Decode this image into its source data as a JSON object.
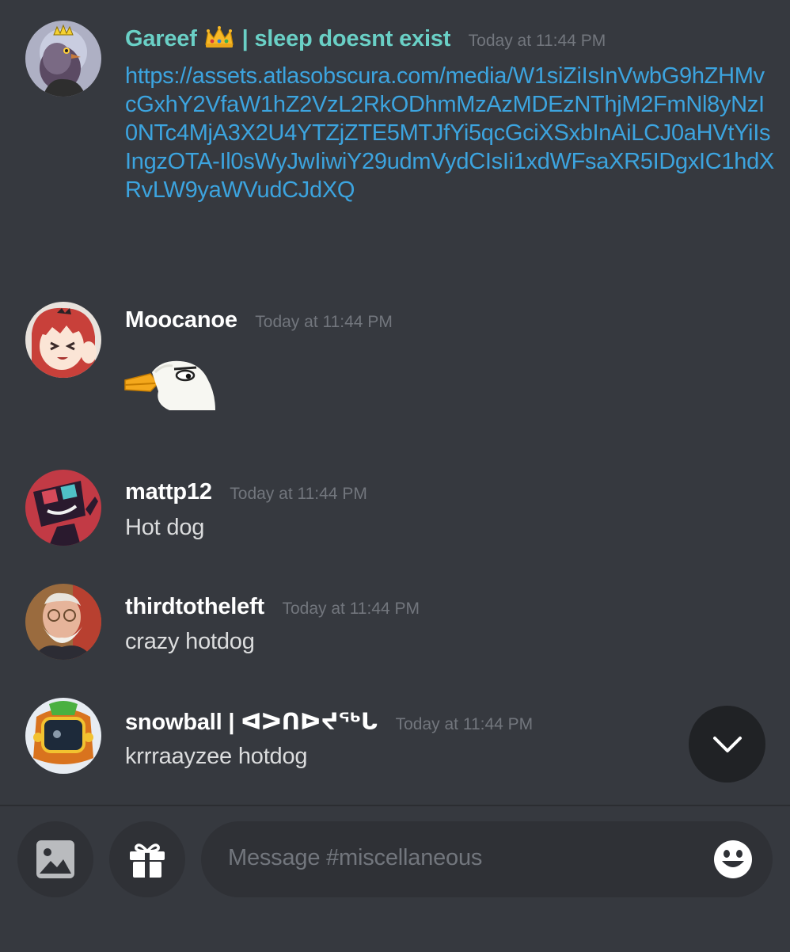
{
  "messages": [
    {
      "username": "Gareef",
      "username_suffix": "| sleep doesnt exist",
      "timestamp": "Today at 11:44 PM",
      "link": "https://assets.atlasobscura.com/media/W1siZiIsInVwbG9hZHMvcGxhY2VfaW1hZ2VzL2RkODhmMzAzMDEzNThjM2FmNl8yNzI0NTc4MjA3X2U4YTZjZTE5MTJfYi5qcGciXSxbInAiLCJ0aHVtYiIsIngzOTA-Il0sWyJwIiwiY29udmVydCIsIi1xdWFsaXR5IDgxIC1hdXRvLW9yaWVudCJdXQ"
    },
    {
      "username": "Moocanoe",
      "timestamp": "Today at 11:44 PM",
      "content_emoji": "goose-emoji"
    },
    {
      "username": "mattp12",
      "timestamp": "Today at 11:44 PM",
      "content": "Hot dog"
    },
    {
      "username": "thirdtotheleft",
      "timestamp": "Today at 11:44 PM",
      "content": "crazy hotdog"
    },
    {
      "username": "snowball | ᐊᐳᑎᐅᔪᖅᒐ",
      "timestamp": "Today at 11:44 PM",
      "content": "krrraayzee hotdog"
    }
  ],
  "composer": {
    "placeholder": "Message #miscellaneous",
    "attach_image_icon": "image-icon",
    "gift_icon": "gift-icon",
    "emoji_icon": "smiley-icon"
  },
  "scroll_down_icon": "chevron-down-icon",
  "colors": {
    "background": "#36393f",
    "input_background": "#2f3136",
    "link": "#3ca4df",
    "teal_username": "#6ad0c6",
    "timestamp": "#72767d"
  }
}
